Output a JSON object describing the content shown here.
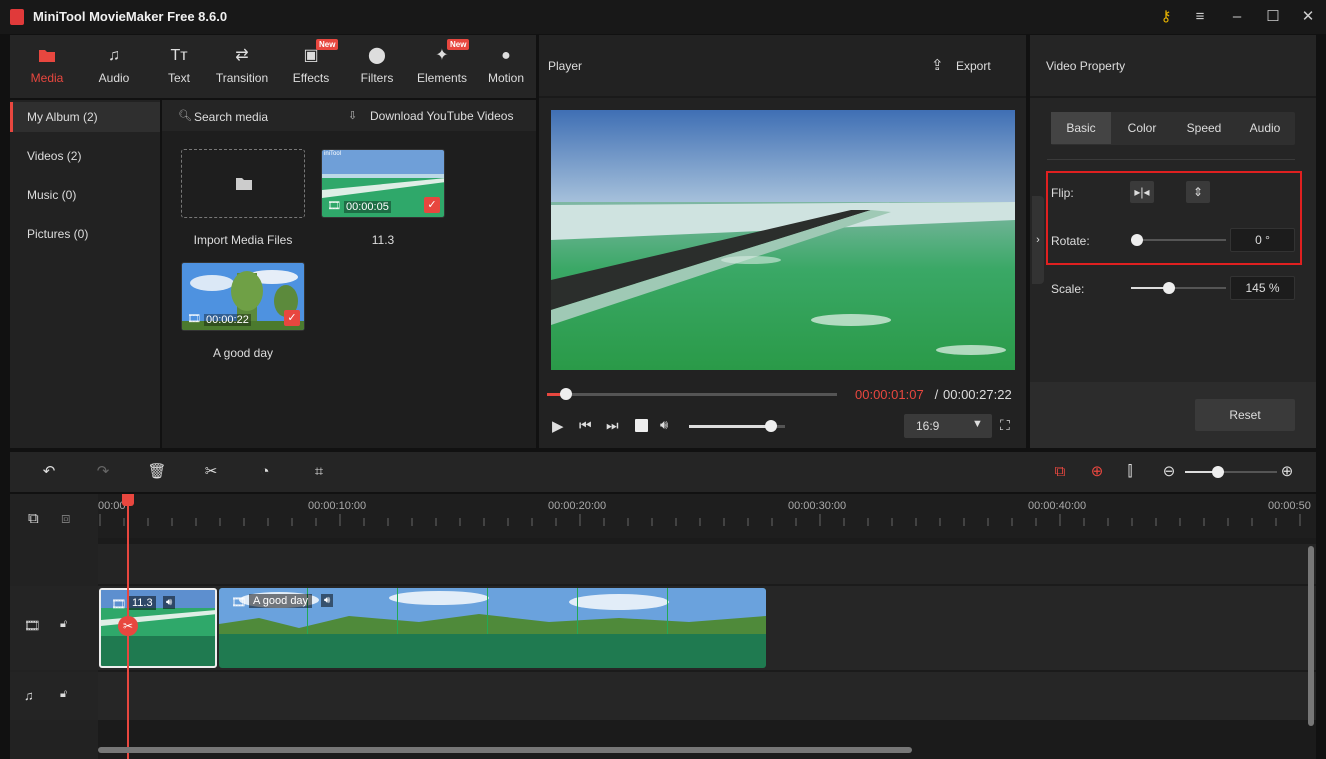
{
  "window": {
    "title": "MiniTool MovieMaker Free 8.6.0"
  },
  "toolbar": {
    "tabs": [
      {
        "label": "Media",
        "icon": "folder-icon",
        "active": true,
        "badge": ""
      },
      {
        "label": "Audio",
        "icon": "music-note-icon",
        "active": false,
        "badge": ""
      },
      {
        "label": "Text",
        "icon": "text-icon",
        "active": false,
        "badge": ""
      },
      {
        "label": "Transition",
        "icon": "transition-arrows-icon",
        "active": false,
        "badge": ""
      },
      {
        "label": "Effects",
        "icon": "effects-icon",
        "active": false,
        "badge": "New"
      },
      {
        "label": "Filters",
        "icon": "filters-icon",
        "active": false,
        "badge": ""
      },
      {
        "label": "Elements",
        "icon": "elements-icon",
        "active": false,
        "badge": "New"
      },
      {
        "label": "Motion",
        "icon": "motion-icon",
        "active": false,
        "badge": ""
      }
    ]
  },
  "sidebar": {
    "items": [
      {
        "label": "My Album (2)",
        "active": true
      },
      {
        "label": "Videos (2)",
        "active": false
      },
      {
        "label": "Music (0)",
        "active": false
      },
      {
        "label": "Pictures (0)",
        "active": false
      }
    ]
  },
  "media": {
    "search_label": "Search media",
    "download_label": "Download YouTube Videos",
    "import_label": "Import Media Files",
    "items": [
      {
        "name": "11.3",
        "duration": "00:00:05",
        "watermark": "iniTool"
      },
      {
        "name": "A good day",
        "duration": "00:00:22"
      }
    ]
  },
  "player": {
    "title": "Player",
    "export_label": "Export",
    "current_time": "00:00:01:07",
    "separator": " / ",
    "total_time": "00:00:27:22",
    "aspect": "16:9",
    "progress": 0.065,
    "volume": 0.85
  },
  "property": {
    "title": "Video Property",
    "tabs": [
      "Basic",
      "Color",
      "Speed",
      "Audio"
    ],
    "active_tab": "Basic",
    "flip_label": "Flip:",
    "rotate_label": "Rotate:",
    "rotate_value": "0 °",
    "rotate_level": 0,
    "scale_label": "Scale:",
    "scale_value": "145 %",
    "scale_level": 0.4,
    "reset_label": "Reset"
  },
  "timeline": {
    "ruler": [
      "00:00",
      "00:00:10:00",
      "00:00:20:00",
      "00:00:30:00",
      "00:00:40:00",
      "00:00:50"
    ],
    "clips": [
      {
        "name": "11.3",
        "selected": true
      },
      {
        "name": "A good day",
        "selected": false
      }
    ],
    "zoom_level": 0.36
  },
  "colors": {
    "accent": "#e8473f",
    "clip_green": "#1f7a50",
    "highlight_box": "#e02020"
  }
}
